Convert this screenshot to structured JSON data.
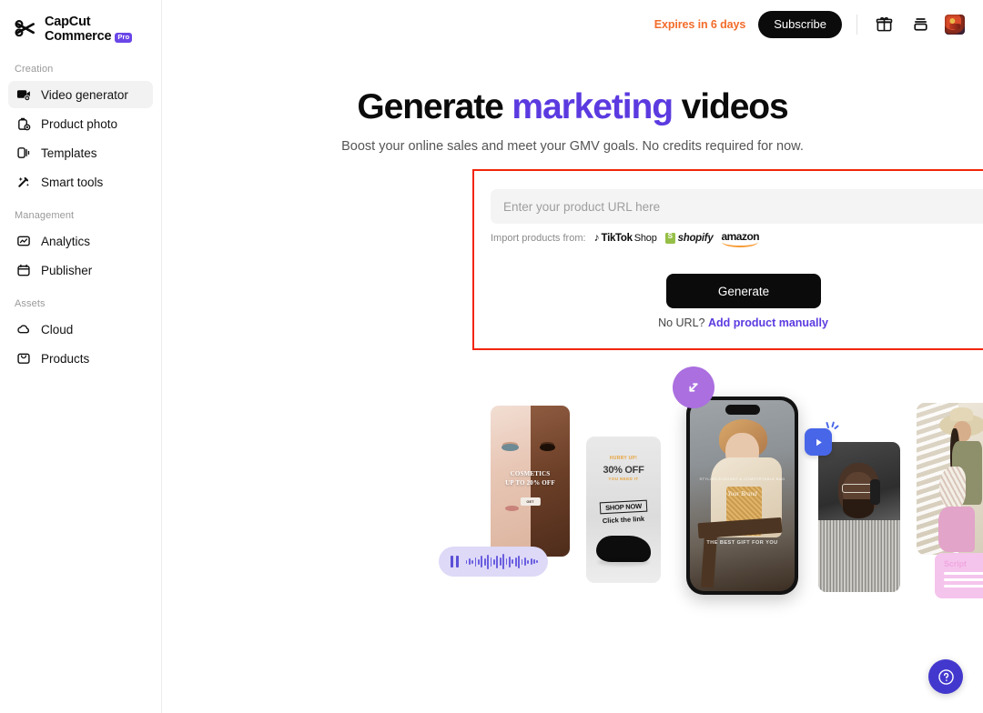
{
  "brand": {
    "line1": "CapCut",
    "line2": "Commerce",
    "badge": "Pro",
    "logo_icon": "capcut-logo-icon"
  },
  "sidebar": {
    "groups": [
      {
        "label": "Creation",
        "items": [
          {
            "label": "Video generator",
            "icon": "video-generator-icon",
            "active": true
          },
          {
            "label": "Product photo",
            "icon": "product-photo-icon",
            "active": false
          },
          {
            "label": "Templates",
            "icon": "templates-icon",
            "active": false
          },
          {
            "label": "Smart tools",
            "icon": "smart-tools-icon",
            "active": false
          }
        ]
      },
      {
        "label": "Management",
        "items": [
          {
            "label": "Analytics",
            "icon": "analytics-icon",
            "active": false
          },
          {
            "label": "Publisher",
            "icon": "publisher-icon",
            "active": false
          }
        ]
      },
      {
        "label": "Assets",
        "items": [
          {
            "label": "Cloud",
            "icon": "cloud-icon",
            "active": false
          },
          {
            "label": "Products",
            "icon": "products-icon",
            "active": false
          }
        ]
      }
    ]
  },
  "topbar": {
    "expires_text": "Expires in 6 days",
    "expires_color": "#f26c2a",
    "subscribe_label": "Subscribe",
    "gift_icon": "gift-icon",
    "credits_icon": "credits-stack-icon",
    "avatar_icon": "user-avatar"
  },
  "hero": {
    "title_part1": "Generate ",
    "title_accent": "marketing",
    "title_part2": " videos",
    "accent_color": "#5b3ae0",
    "subtitle": "Boost your online sales and meet your GMV goals. No credits required for now."
  },
  "url_panel": {
    "highlight_color": "#f2250b",
    "input_value": "",
    "input_placeholder": "Enter your product URL here",
    "import_label": "Import products from:",
    "brands": [
      {
        "name": "TikTok Shop",
        "note": "TikTok",
        "suffix": "Shop"
      },
      {
        "name": "shopify"
      },
      {
        "name": "amazon"
      }
    ],
    "generate_label": "Generate",
    "no_url_text": "No URL? ",
    "add_manually_label": "Add product manually"
  },
  "gallery": {
    "cards": [
      {
        "name": "cosmetics-card",
        "text_line1": "COSMETICS",
        "text_line2": "UP TO 20% OFF",
        "chip": "GET"
      },
      {
        "name": "shoe-promo-card",
        "hurry": "HURRY UP!",
        "discount": "30% OFF",
        "need_it": "YOU NEED IT",
        "shop_now": "SHOP NOW",
        "click_link": "Click the link"
      },
      {
        "name": "phone-mockup-card",
        "overlay_line1": "STYLISH ELEGANT & COMFORTABLE BAG",
        "overlay_line2": "Your Brand",
        "overlay_line3": "THE BEST GIFT FOR YOU"
      },
      {
        "name": "headphones-card"
      },
      {
        "name": "hat-woman-card"
      }
    ],
    "overlays": {
      "crop_icon": "crop-resize-icon",
      "crop_color": "#ab6fe0",
      "play_icon": "play-icon",
      "play_color": "#4866e8",
      "audio_pause_icon": "pause-icon",
      "audio_color": "#ddd9f7",
      "script_title": "Script",
      "script_color": "#f5c4ec",
      "cursor_icon": "cursor-arrow-icon"
    }
  },
  "help": {
    "icon": "question-mark-icon",
    "color": "#4338cd"
  }
}
